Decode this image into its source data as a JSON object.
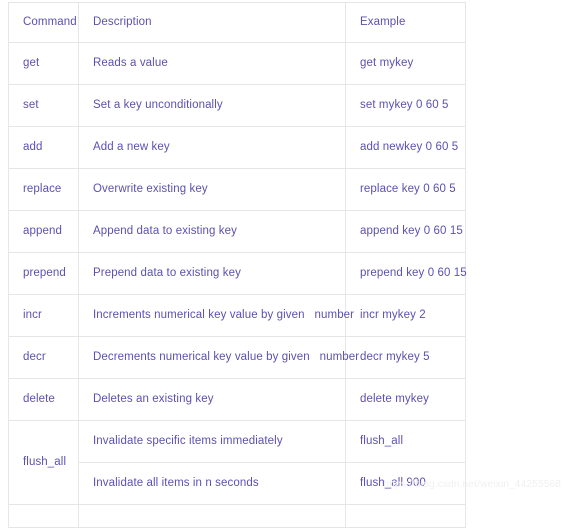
{
  "table": {
    "headers": {
      "command": "Command",
      "description": "Description",
      "example": "Example"
    },
    "accent_text_color": "#5b51b0",
    "border_color": "#e6e6e6",
    "rows": [
      {
        "command": "get",
        "description": "Reads a value",
        "example": "get mykey"
      },
      {
        "command": "set",
        "description": "Set a key unconditionally",
        "example": "set mykey 0 60 5"
      },
      {
        "command": "add",
        "description": "Add a new key",
        "example": "add newkey 0 60 5"
      },
      {
        "command": "replace",
        "description": "Overwrite existing key",
        "example": "replace key 0 60 5"
      },
      {
        "command": "append",
        "description": "Append data to existing key",
        "example": "append key 0 60 15"
      },
      {
        "command": "prepend",
        "description": "Prepend data to existing key",
        "example": "prepend key 0 60 15"
      },
      {
        "command": "incr",
        "description": "Increments numerical key value by given   number",
        "example": "incr mykey 2"
      },
      {
        "command": "decr",
        "description": "Decrements numerical key value by given   number",
        "example": "decr mykey 5"
      },
      {
        "command": "delete",
        "description": "Deletes an existing key",
        "example": "delete mykey"
      }
    ],
    "merged_row": {
      "command": "flush_all",
      "subrows": [
        {
          "description": "Invalidate specific items immediately",
          "example": "flush_all"
        },
        {
          "description": "Invalidate all items in n seconds",
          "example": "flush_all 900"
        }
      ]
    }
  },
  "watermark": {
    "text": "https://blog.csdn.net/weixin_44255568"
  }
}
